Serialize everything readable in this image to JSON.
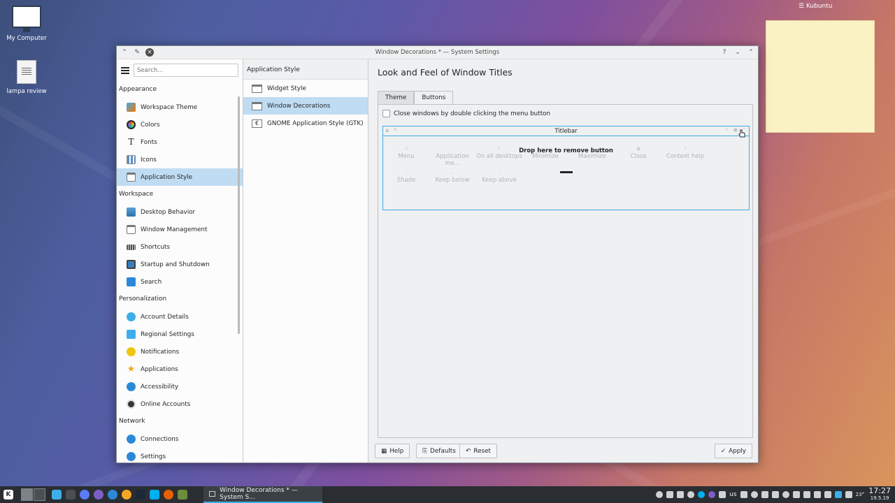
{
  "desktop": {
    "icons": [
      {
        "label": "My Computer"
      },
      {
        "label": "lampa review"
      }
    ],
    "panel_label": "Kubuntu"
  },
  "window": {
    "title": "Window Decorations * — System Settings",
    "controls": {
      "help": "?",
      "minimize": "⌄",
      "maximize": "⌃"
    }
  },
  "sidebar": {
    "search_placeholder": "Search...",
    "categories": {
      "appearance": "Appearance",
      "workspace": "Workspace",
      "personalization": "Personalization",
      "network": "Network"
    },
    "items": {
      "workspace_theme": "Workspace Theme",
      "colors": "Colors",
      "fonts": "Fonts",
      "icons": "Icons",
      "application_style": "Application Style",
      "desktop_behavior": "Desktop Behavior",
      "window_management": "Window Management",
      "shortcuts": "Shortcuts",
      "startup_shutdown": "Startup and Shutdown",
      "search": "Search",
      "account_details": "Account Details",
      "regional_settings": "Regional Settings",
      "notifications": "Notifications",
      "applications": "Applications",
      "accessibility": "Accessibility",
      "online_accounts": "Online Accounts",
      "connections": "Connections",
      "settings": "Settings"
    }
  },
  "midpane": {
    "header": "Application Style",
    "items": {
      "widget_style": "Widget Style",
      "window_decorations": "Window Decorations",
      "gnome_style": "GNOME Application Style (GTK)"
    }
  },
  "content": {
    "title": "Look and Feel of Window Titles",
    "tabs": {
      "theme": "Theme",
      "buttons": "Buttons"
    },
    "checkbox_label": "Close windows by double clicking the menu button",
    "preview": {
      "titlebar_label": "Titlebar",
      "drop_hint": "Drop here to remove button",
      "buttons": {
        "menu": "Menu",
        "app_menu": "Application me...",
        "on_all_desktops": "On all desktops",
        "minimize": "Minimize",
        "maximize": "Maximize",
        "close": "Close",
        "context_help": "Context help",
        "shade": "Shade",
        "keep_below": "Keep below",
        "keep_above": "Keep above"
      }
    }
  },
  "buttons": {
    "help": "Help",
    "defaults": "Defaults",
    "reset": "Reset",
    "apply": "Apply"
  },
  "taskbar": {
    "task_label": "Window Decorations * — System S...",
    "keyboard_layout": "us",
    "clock_time": "17:27",
    "clock_date": "19.5.19",
    "temperature": "23°"
  },
  "colors": {
    "selection": "#c0dcf3",
    "accent": "#3daee9",
    "panel": "#2a2e32"
  }
}
